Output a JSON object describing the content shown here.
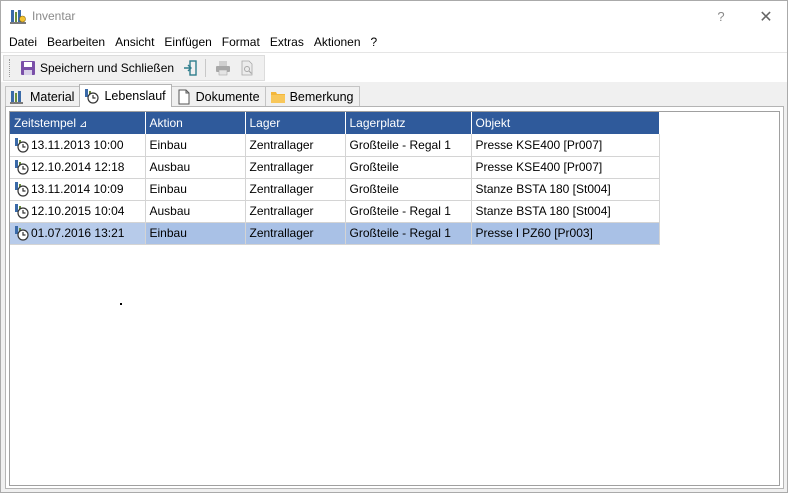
{
  "window": {
    "title": "Inventar",
    "help_glyph": "?",
    "close_glyph": "✕"
  },
  "menu": {
    "items": [
      "Datei",
      "Bearbeiten",
      "Ansicht",
      "Einfügen",
      "Format",
      "Extras",
      "Aktionen",
      "?"
    ]
  },
  "toolbar": {
    "save_label": "Speichern und Schließen",
    "icons": [
      "save-icon",
      "exit-icon",
      "print-icon",
      "print-preview-icon"
    ]
  },
  "tabs": [
    {
      "label": "Material",
      "icon": "material-icon",
      "active": false
    },
    {
      "label": "Lebenslauf",
      "icon": "history-icon",
      "active": true
    },
    {
      "label": "Dokumente",
      "icon": "document-icon",
      "active": false
    },
    {
      "label": "Bemerkung",
      "icon": "folder-icon",
      "active": false
    }
  ],
  "grid": {
    "sort_glyph": "⊿",
    "columns": [
      "Zeitstempel",
      "Aktion",
      "Lager",
      "Lagerplatz",
      "Objekt"
    ],
    "rows": [
      [
        "13.11.2013 10:00",
        "Einbau",
        "Zentrallager",
        "Großteile - Regal 1",
        "Presse KSE400 [Pr007]"
      ],
      [
        "12.10.2014 12:18",
        "Ausbau",
        "Zentrallager",
        "Großteile",
        "Presse KSE400 [Pr007]"
      ],
      [
        "13.11.2014 10:09",
        "Einbau",
        "Zentrallager",
        "Großteile",
        "Stanze BSTA 180 [St004]"
      ],
      [
        "12.10.2015 10:04",
        "Ausbau",
        "Zentrallager",
        "Großteile - Regal 1",
        "Stanze BSTA 180 [St004]"
      ],
      [
        "01.07.2016 13:21",
        "Einbau",
        "Zentrallager",
        "Großteile - Regal 1",
        "Presse l PZ60 [Pr003]"
      ]
    ],
    "selected_row": 4
  },
  "colors": {
    "header_bg": "#2f5a9b",
    "selected_bg": "#a9c1e6"
  }
}
